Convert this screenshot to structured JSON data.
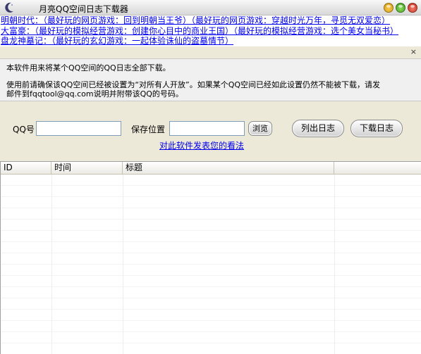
{
  "window": {
    "title": "月亮QQ空间日志下载器"
  },
  "ads": {
    "line1": "明朝时代：（最好玩的网页游戏：回到明朝当王爷）（最好玩的网页游戏：穿越时光万年，寻觅无双爱恋）",
    "line2": "大富豪：（最好玩的模拟经营游戏：创建你心目中的商业王国）（最好玩的模拟经营游戏：选个美女当秘书）",
    "line3": "盘龙神墓记：（最好玩的玄幻游戏：一起体验诛仙的盗墓情节）",
    "close_glyph": "×"
  },
  "info": {
    "line1": "本软件用来将某个QQ空间的QQ日志全部下载。",
    "line2": "使用前请确保该QQ空间已经被设置为“对所有人开放”。如果某个QQ空间已经如此设置仍然不能被下载，请发",
    "line3": "邮件到fqqtool@qq.com说明并附带该QQ的号码。"
  },
  "form": {
    "qq_label": "QQ号",
    "qq_value": "",
    "save_label": "保存位置",
    "save_value": "",
    "browse_label": "浏览",
    "list_label": "列出日志",
    "download_label": "下载日志",
    "feedback_link": "对此软件发表您的看法"
  },
  "table": {
    "columns": [
      "ID",
      "时间",
      "标题",
      ""
    ],
    "rows": []
  }
}
